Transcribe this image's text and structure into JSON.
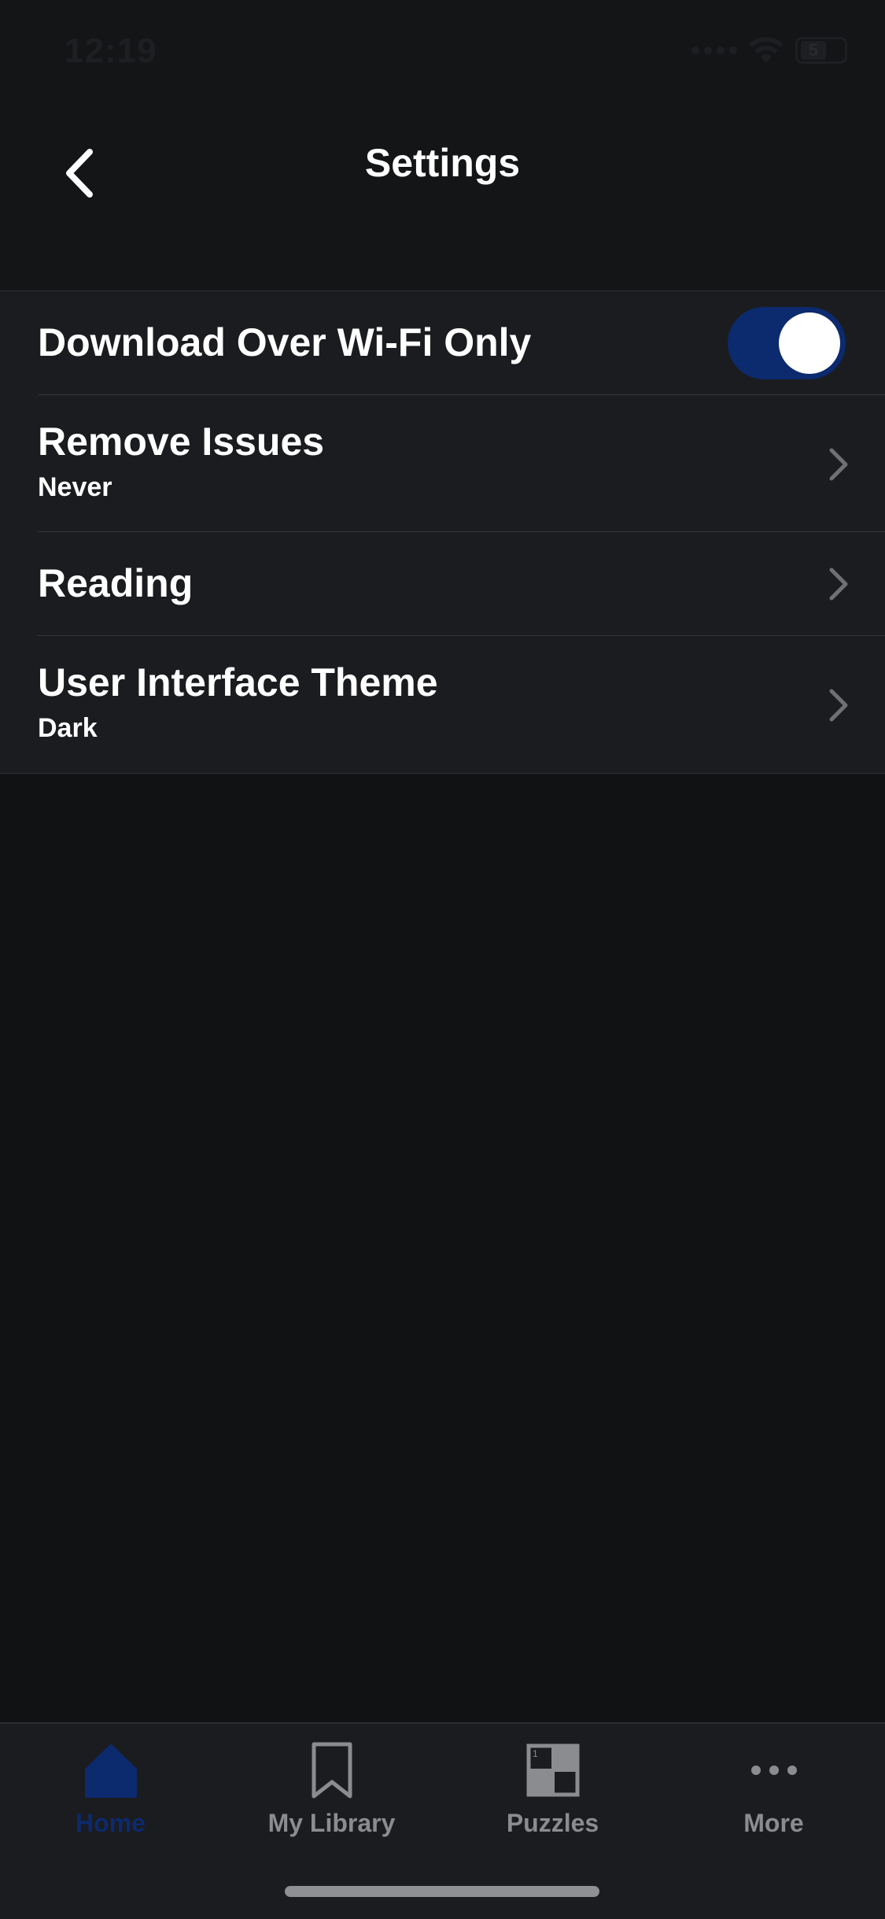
{
  "status_bar": {
    "time": "12:19",
    "battery": "5"
  },
  "header": {
    "title": "Settings"
  },
  "settings": {
    "wifi_only": {
      "label": "Download Over Wi-Fi Only",
      "enabled": true
    },
    "remove_issues": {
      "label": "Remove Issues",
      "value": "Never"
    },
    "reading": {
      "label": "Reading"
    },
    "theme": {
      "label": "User Interface Theme",
      "value": "Dark"
    }
  },
  "tabs": [
    {
      "label": "Home",
      "icon": "home-icon",
      "active": true
    },
    {
      "label": "My Library",
      "icon": "bookmark-icon",
      "active": false
    },
    {
      "label": "Puzzles",
      "icon": "crossword-icon",
      "active": false
    },
    {
      "label": "More",
      "icon": "more-dots-icon",
      "active": false
    }
  ],
  "colors": {
    "background": "#111214",
    "row_background": "#1b1c1f",
    "accent": "#0c2a6e",
    "inactive_tab": "#8a8c90"
  }
}
